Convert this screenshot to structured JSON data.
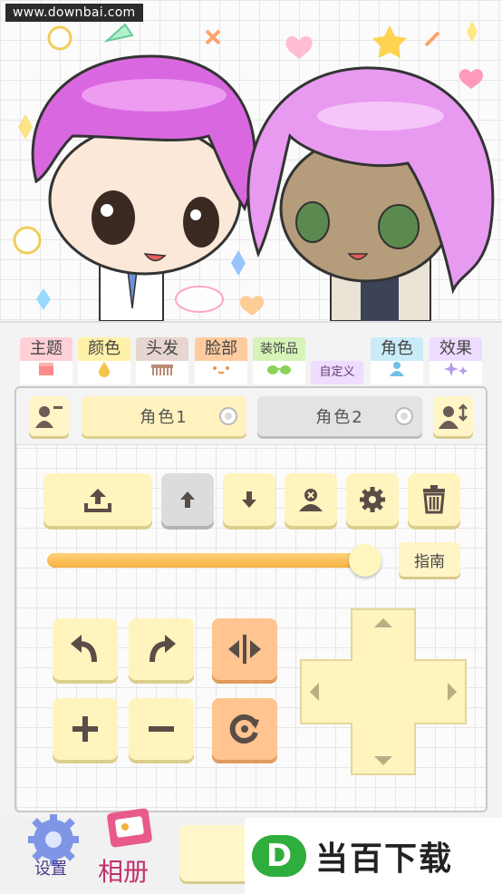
{
  "watermark": "www.downbai.com",
  "tabs": [
    {
      "label": "主题",
      "bg": "#ffd0d6",
      "icon": "clapperboard-icon"
    },
    {
      "label": "颜色",
      "bg": "#fff1a8",
      "icon": "droplet-icon"
    },
    {
      "label": "头发",
      "bg": "#e6d6cf",
      "icon": "comb-icon"
    },
    {
      "label": "脸部",
      "bg": "#ffcc9f",
      "icon": "face-icon"
    },
    {
      "label": "装饰品",
      "bg": "#d6f3b8",
      "icon": "sunglasses-icon"
    },
    {
      "label": "角色",
      "bg": "#c9ecf8",
      "icon": "person-icon"
    },
    {
      "label": "效果",
      "bg": "#eddcff",
      "icon": "sparkle-icon"
    }
  ],
  "custom_tab": "自定义",
  "characters": {
    "tab1": "角色1",
    "tab2": "角色2",
    "active": 1
  },
  "slider": {
    "value": 0.97
  },
  "guide_label": "指南",
  "bottom": {
    "settings_label": "设置",
    "album_label": "相册",
    "brand_name": "当百下载",
    "brand_logo": "D"
  }
}
